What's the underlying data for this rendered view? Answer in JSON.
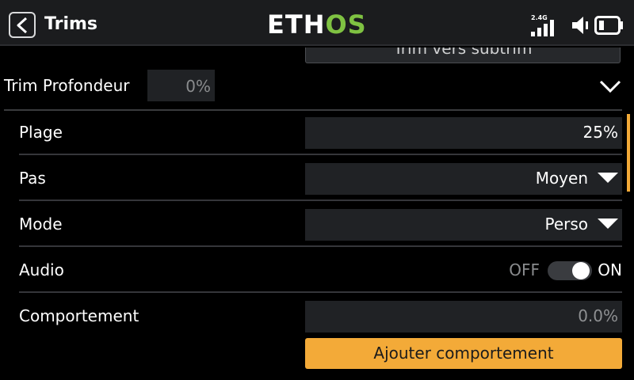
{
  "header": {
    "title": "Trims",
    "logo_left": "ETH",
    "logo_right": "OS",
    "rf_band": "2.4G",
    "icons": [
      "back-arrow-icon",
      "signal-strength-icon",
      "speaker-icon",
      "battery-icon"
    ]
  },
  "top_button": {
    "label": "Trim vers subtrim"
  },
  "trim_section": {
    "label": "Trim Profondeur",
    "value": "0%"
  },
  "rows": {
    "plage": {
      "label": "Plage",
      "value": "25%"
    },
    "pas": {
      "label": "Pas",
      "value": "Moyen"
    },
    "mode": {
      "label": "Mode",
      "value": "Perso"
    },
    "audio": {
      "label": "Audio",
      "off_label": "OFF",
      "on_label": "ON",
      "state": "on"
    },
    "comportement": {
      "label": "Comportement",
      "value": "0.0%"
    }
  },
  "add_button": {
    "label": "Ajouter comportement"
  },
  "colors": {
    "accent": "#f3aa38",
    "logo_green": "#7fc242",
    "background": "#000000",
    "field_bg": "#202225"
  }
}
